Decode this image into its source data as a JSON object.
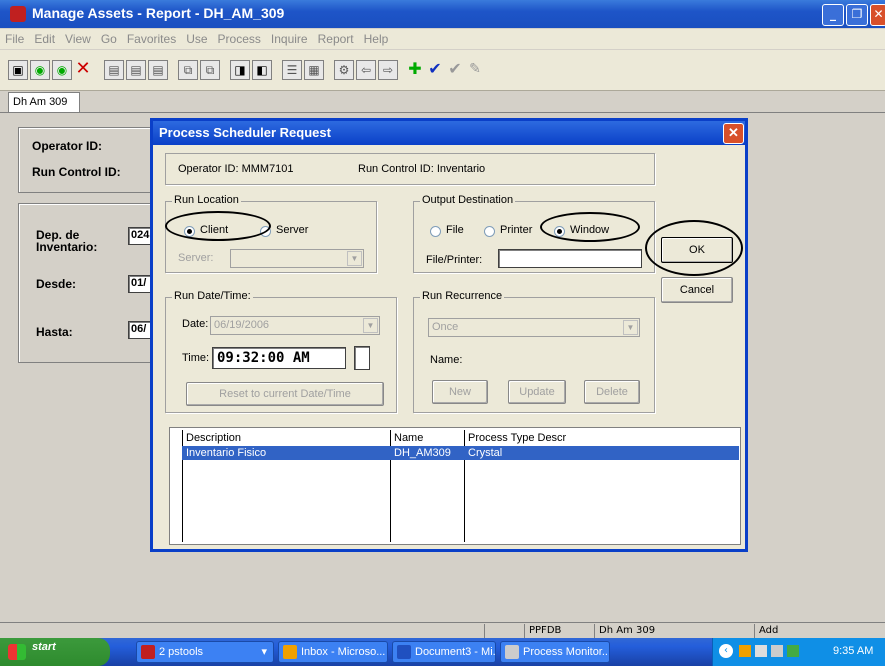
{
  "window": {
    "title": "Manage Assets - Report - DH_AM_309"
  },
  "menu": [
    "File",
    "Edit",
    "View",
    "Go",
    "Favorites",
    "Use",
    "Process",
    "Inquire",
    "Report",
    "Help"
  ],
  "page_tab": "Dh Am 309",
  "form": {
    "operator_label": "Operator ID:",
    "run_control_label": "Run Control ID:",
    "dep_label": "Dep. de Inventario:",
    "dep_value": "024",
    "desde_label": "Desde:",
    "desde_value": "01/",
    "hasta_label": "Hasta:",
    "hasta_value": "06/"
  },
  "dialog": {
    "title": "Process Scheduler Request",
    "operator_text": "Operator ID:   MMM7101",
    "run_control_text": "Run Control ID:   Inventario",
    "run_location": {
      "legend": "Run Location",
      "client": "Client",
      "server": "Server",
      "server_field_label": "Server:",
      "selected": "Client"
    },
    "output": {
      "legend": "Output Destination",
      "file": "File",
      "printer": "Printer",
      "window": "Window",
      "file_printer_label": "File/Printer:",
      "selected": "Window"
    },
    "ok_label": "OK",
    "cancel_label": "Cancel",
    "run_datetime": {
      "legend": "Run Date/Time:",
      "date_label": "Date:",
      "date_value": "06/19/2006",
      "time_label": "Time:",
      "time_value": "09:32:00 AM",
      "reset_label": "Reset to current Date/Time"
    },
    "recurrence": {
      "legend": "Run Recurrence",
      "value": "Once",
      "name_label": "Name:",
      "new_label": "New",
      "update_label": "Update",
      "delete_label": "Delete"
    },
    "grid": {
      "headers": [
        "Description",
        "Name",
        "Process Type Descr"
      ],
      "rows": [
        [
          "Inventario Fisico",
          "DH_AM309",
          "Crystal"
        ]
      ]
    }
  },
  "status": {
    "server": "PPFDB",
    "page": "Dh Am 309",
    "mode": "Add"
  },
  "taskbar": {
    "start": "start",
    "tasks": [
      "2 pstools",
      "Inbox - Microso...",
      "Document3 - Mi...",
      "Process Monitor..."
    ],
    "clock": "9:35 AM"
  }
}
